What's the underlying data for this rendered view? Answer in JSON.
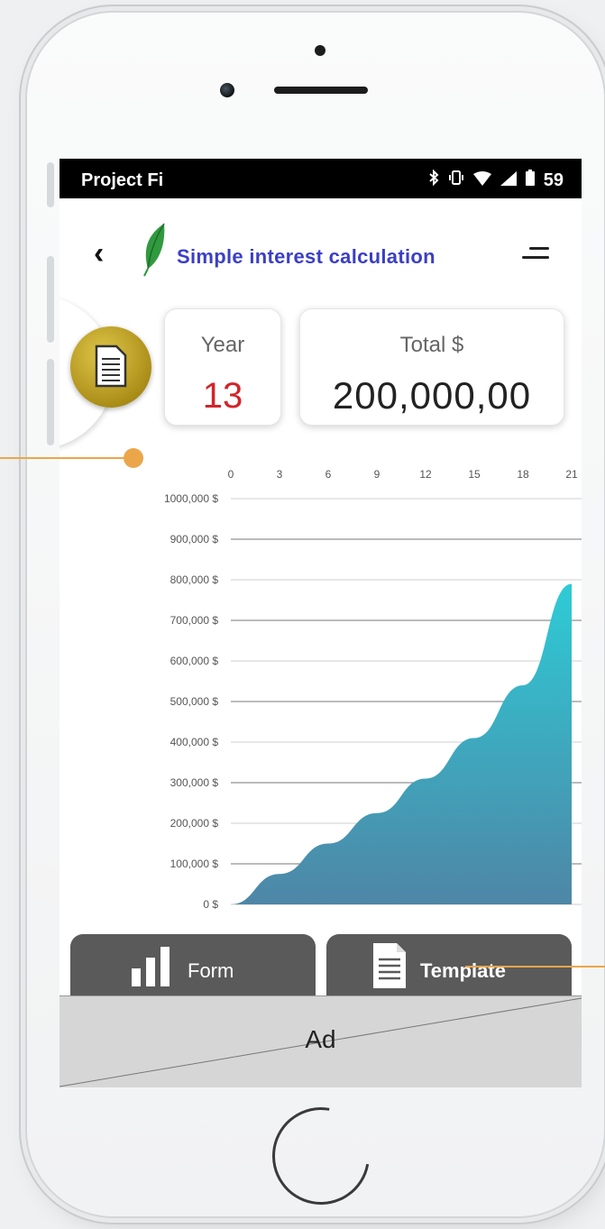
{
  "status_bar": {
    "carrier": "Project Fi",
    "time": "59",
    "icons": [
      "bluetooth-icon",
      "vibrate-icon",
      "wifi-icon",
      "signal-icon",
      "battery-icon"
    ]
  },
  "header": {
    "title": "Simple interest calculation",
    "icons": [
      "back-icon",
      "leaf-icon",
      "menu-icon"
    ]
  },
  "summary": {
    "year_label": "Year",
    "year_value": "13",
    "total_label": "Total $",
    "total_value": "200,000,00"
  },
  "chart_data": {
    "type": "area",
    "title": "",
    "xlabel": "",
    "ylabel": "",
    "x_ticks": [
      "0",
      "3",
      "6",
      "9",
      "12",
      "15",
      "18",
      "21"
    ],
    "y_ticks": [
      "1000,000 $",
      "900,000 $",
      "800,000 $",
      "700,000 $",
      "600,000 $",
      "500,000 $",
      "400,000 $",
      "300,000 $",
      "200,000 $",
      "100,000 $",
      "0 $"
    ],
    "xlim": [
      0,
      21
    ],
    "ylim": [
      0,
      1000000
    ],
    "grid": true,
    "x": [
      0,
      3,
      6,
      9,
      12,
      15,
      18,
      21
    ],
    "values": [
      0,
      75000,
      150000,
      225000,
      310000,
      410000,
      540000,
      790000
    ],
    "colors": {
      "top": "#2ecbd6",
      "bottom": "#4e86a6"
    }
  },
  "tabs": [
    {
      "label": "Form",
      "icon": "bar-chart-icon"
    },
    {
      "label": "Template",
      "icon": "document-icon"
    }
  ],
  "ad": {
    "label": "Ad"
  },
  "colors": {
    "title": "#3b3fc5",
    "year_value": "#d3242a",
    "tab_bg": "#5a5a5a",
    "callout": "#eca64a"
  }
}
